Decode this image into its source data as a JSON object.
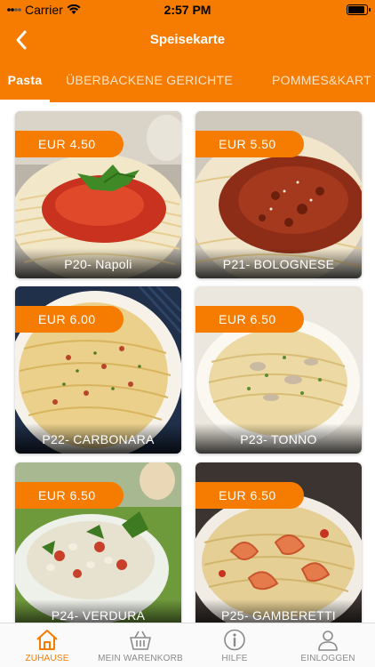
{
  "status_bar": {
    "carrier": "Carrier",
    "time": "2:57 PM"
  },
  "nav": {
    "title": "Speisekarte"
  },
  "tabs": [
    {
      "label": "Pasta",
      "active": true
    },
    {
      "label": "ÜBERBACKENE GERICHTE",
      "active": false
    },
    {
      "label": "POMMES&KART",
      "active": false
    }
  ],
  "menu": {
    "items": [
      {
        "name": "P20- Napoli",
        "price": "EUR  4.50"
      },
      {
        "name": "P21- BOLOGNESE",
        "price": "EUR  5.50"
      },
      {
        "name": "P22- CARBONARA",
        "price": "EUR  6.00"
      },
      {
        "name": "P23- TONNO",
        "price": "EUR  6.50"
      },
      {
        "name": "P24- VERDURA",
        "price": "EUR  6.50"
      },
      {
        "name": "P25- GAMBERETTI",
        "price": "EUR  6.50"
      }
    ]
  },
  "bottom_nav": [
    {
      "label": "ZUHAUSE",
      "icon": "home-icon",
      "active": true
    },
    {
      "label": "MEIN WARENKORB",
      "icon": "basket-icon",
      "active": false
    },
    {
      "label": "HILFE",
      "icon": "info-icon",
      "active": false
    },
    {
      "label": "EINLOGGEN",
      "icon": "user-icon",
      "active": false
    }
  ],
  "colors": {
    "accent": "#f57c00",
    "tab_inactive": "#ffe3c4",
    "nav_inactive": "#8a8a8a"
  }
}
